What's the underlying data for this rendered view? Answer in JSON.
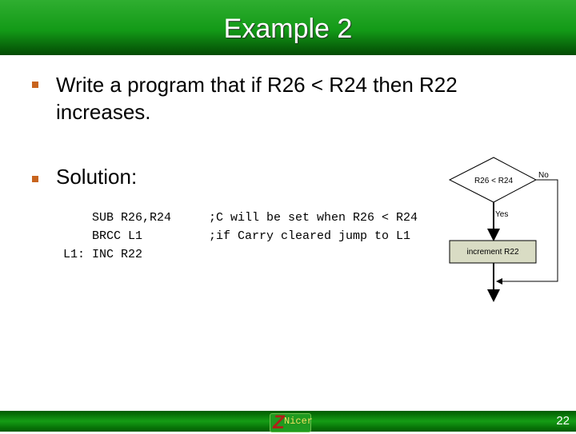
{
  "title": "Example 2",
  "bullets": [
    "Write a program that if R26 < R24 then R22 increases.",
    "Solution:"
  ],
  "code": {
    "lines": [
      "SUB R26,R24",
      "BRCC L1",
      "INC R22"
    ],
    "comments": [
      ";C will be set when R26 < R24",
      ";if Carry cleared jump to L1"
    ],
    "label": "L1:"
  },
  "flowchart": {
    "decision": "R26 < R24",
    "no": "No",
    "yes": "Yes",
    "process": "increment R22",
    "process_fill": "#d9dcc4"
  },
  "footer": {
    "logo": "Nicer",
    "page": "22"
  },
  "colors": {
    "accent": "#139a17",
    "bullet": "#c8641e"
  }
}
